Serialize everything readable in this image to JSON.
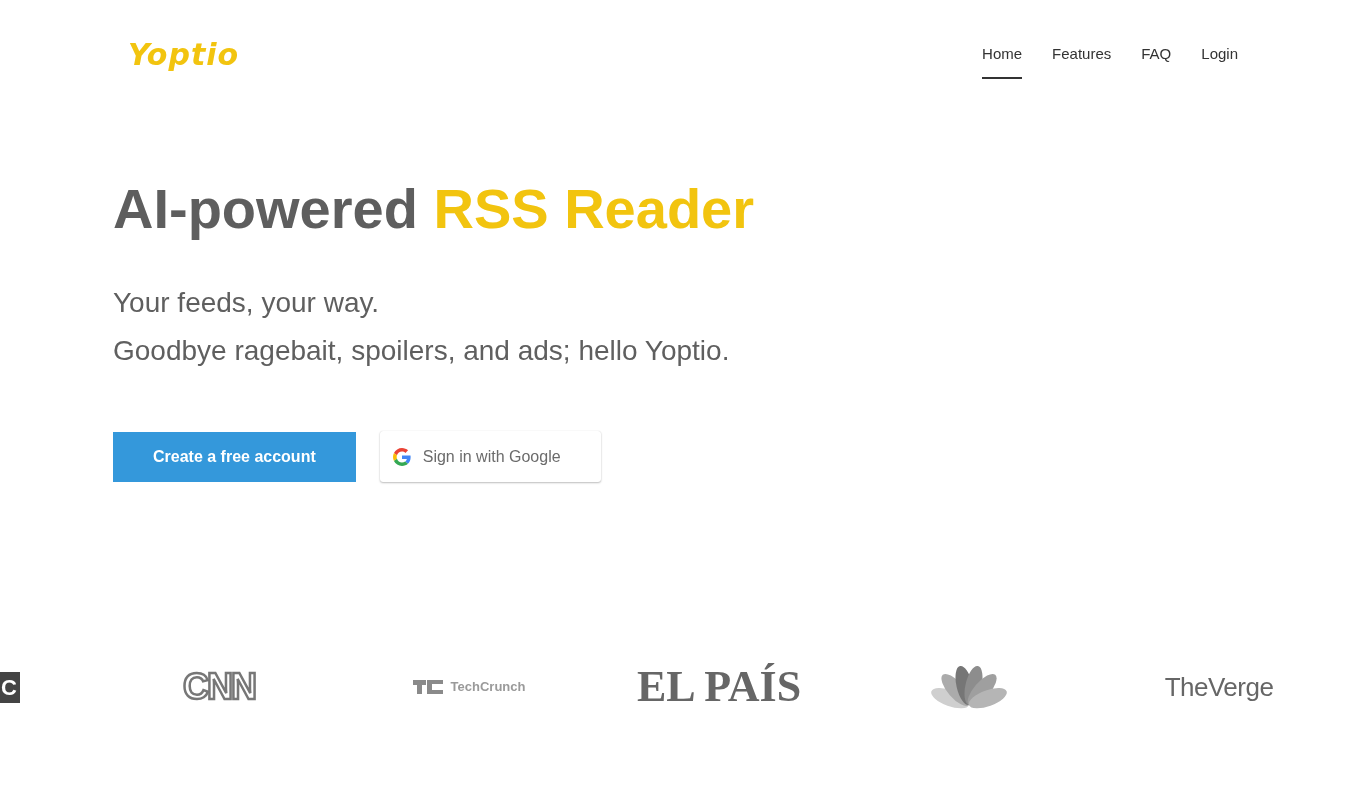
{
  "header": {
    "logo": "Yoptio",
    "nav": [
      {
        "label": "Home",
        "selected": true
      },
      {
        "label": "Features",
        "selected": false
      },
      {
        "label": "FAQ",
        "selected": false
      },
      {
        "label": "Login",
        "selected": false
      }
    ]
  },
  "hero": {
    "title": "AI-powered",
    "title_highlight": "RSS Reader",
    "taglines": [
      "Your feeds, your way.",
      "Goodbye ragebait, spoilers, and ads; hello Yoptio."
    ],
    "buttons": [
      {
        "kind": "primary",
        "label": "Create a free account"
      },
      {
        "kind": "google",
        "label": "Sign in with Google"
      }
    ]
  },
  "logos": [
    {
      "kind": "box",
      "text": "C"
    },
    {
      "kind": "outline",
      "text": "CNN"
    },
    {
      "kind": "blocks",
      "text": "Tech**Crunch**"
    },
    {
      "kind": "serif",
      "text": "EL PAÍS"
    },
    {
      "kind": "peacock"
    },
    {
      "kind": "geometric",
      "text": "TheVerge"
    }
  ]
}
